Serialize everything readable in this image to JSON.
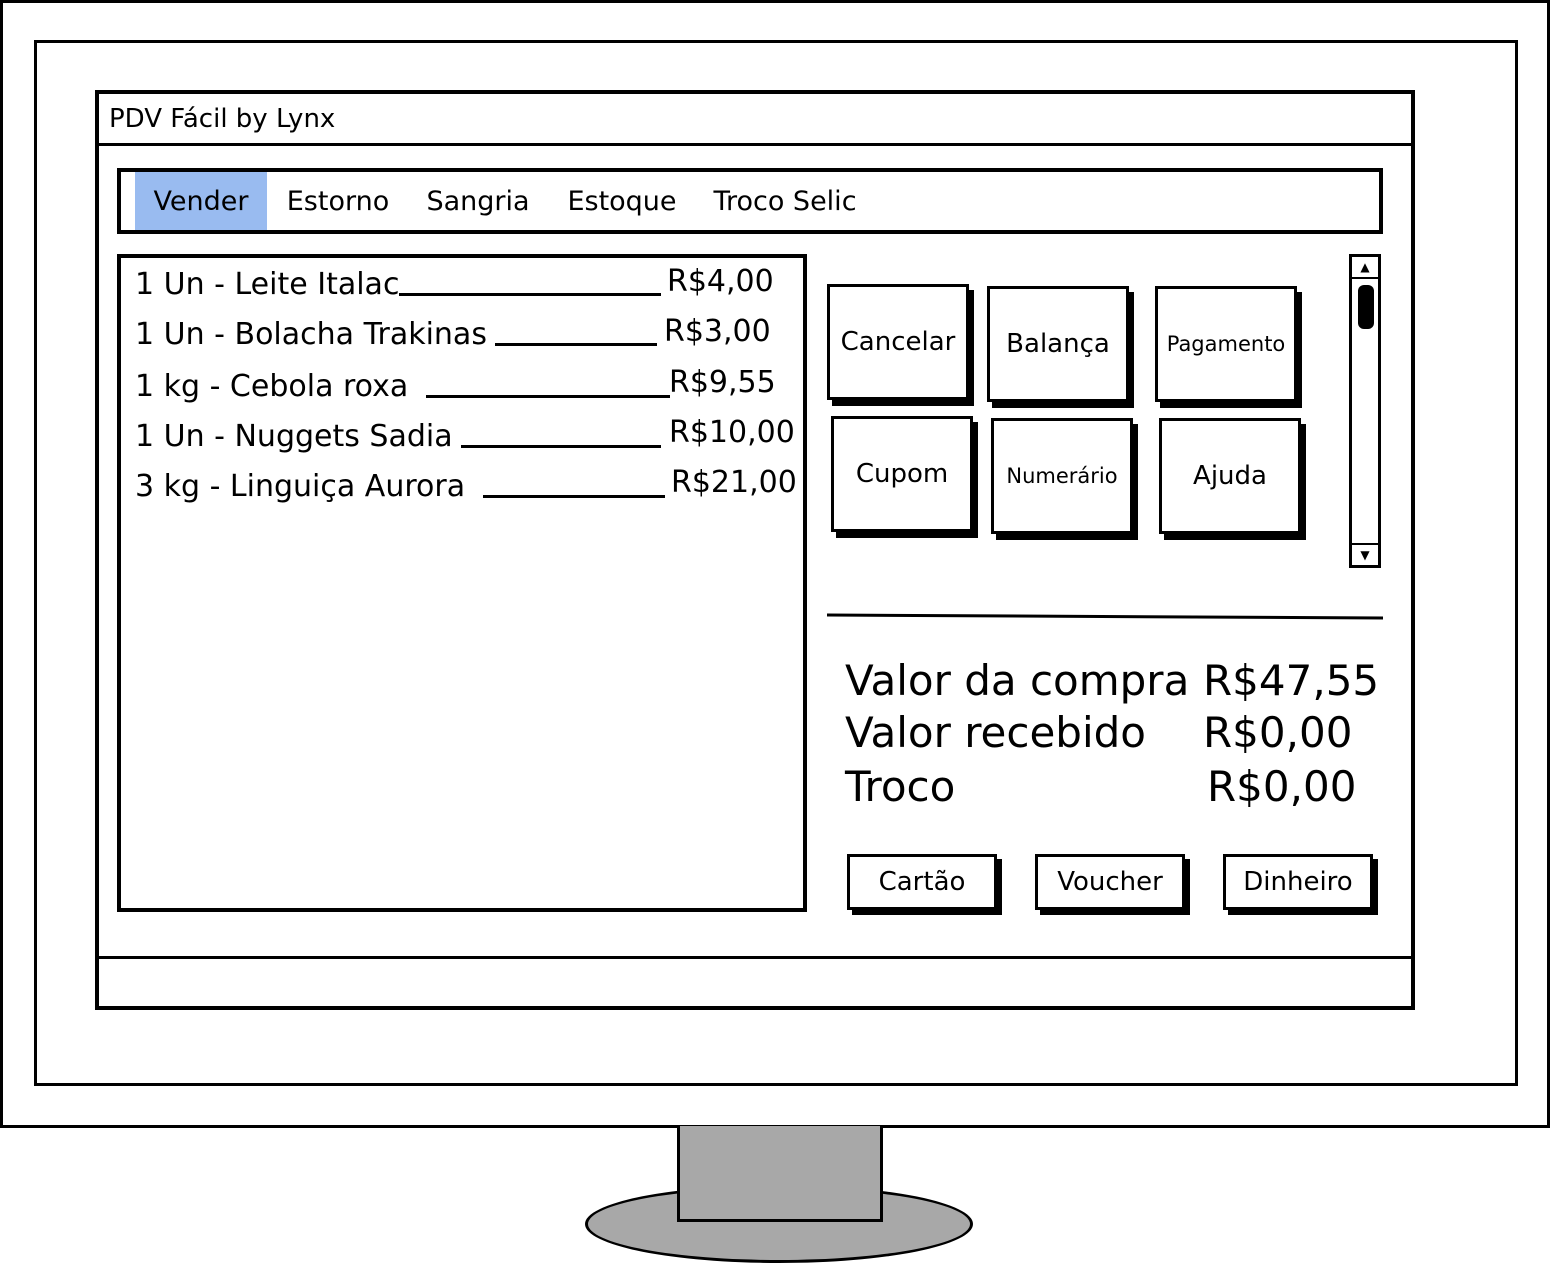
{
  "window": {
    "title": "PDV Fácil by Lynx"
  },
  "tabs": [
    {
      "label": "Vender",
      "active": true
    },
    {
      "label": "Estorno",
      "active": false
    },
    {
      "label": "Sangria",
      "active": false
    },
    {
      "label": "Estoque",
      "active": false
    },
    {
      "label": "Troco Selic",
      "active": false
    }
  ],
  "items": [
    {
      "description": "1 Un - Leite Italac",
      "price": "R$4,00"
    },
    {
      "description": "1 Un - Bolacha Trakinas",
      "price": "R$3,00"
    },
    {
      "description": "1 kg - Cebola roxa",
      "price": "R$9,55"
    },
    {
      "description": "1 Un - Nuggets Sadia",
      "price": "R$10,00"
    },
    {
      "description": "3 kg - Linguiça Aurora",
      "price": "R$21,00"
    }
  ],
  "function_buttons": [
    {
      "label": "Cancelar"
    },
    {
      "label": "Balança"
    },
    {
      "label": "Pagamento"
    },
    {
      "label": "Cupom"
    },
    {
      "label": "Numerário"
    },
    {
      "label": "Ajuda"
    }
  ],
  "totals": {
    "purchase_label": "Valor da compra",
    "purchase_value": "R$47,55",
    "received_label": "Valor recebido",
    "received_value": "R$0,00",
    "change_label": "Troco",
    "change_value": "R$0,00"
  },
  "payment_buttons": [
    {
      "label": "Cartão"
    },
    {
      "label": "Voucher"
    },
    {
      "label": "Dinheiro"
    }
  ],
  "colors": {
    "active_tab": "#99bbf0",
    "stand": "#a8a8a8"
  }
}
